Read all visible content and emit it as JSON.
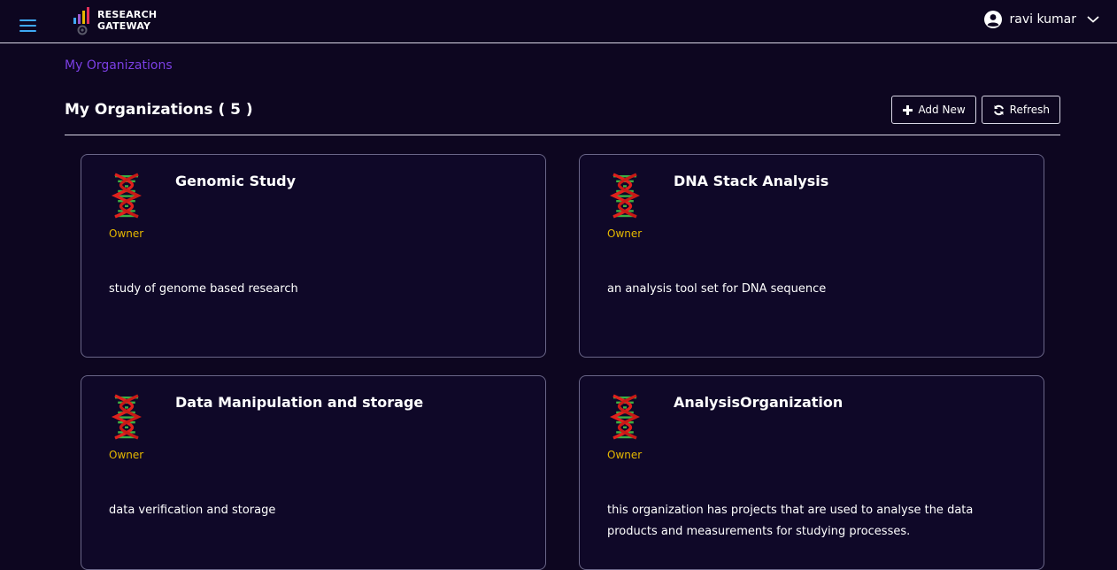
{
  "header": {
    "logo_line1": "RESEARCH",
    "logo_line2": "GATEWAY",
    "user_name": "ravi kumar"
  },
  "breadcrumb": "My Organizations",
  "page": {
    "title": "My Organizations ( 5 )",
    "add_new_label": "Add New",
    "refresh_label": "Refresh"
  },
  "organizations": [
    {
      "name": "Genomic Study",
      "role": "Owner",
      "description": "study of genome based research"
    },
    {
      "name": "DNA Stack Analysis",
      "role": "Owner",
      "description": "an analysis tool set for DNA sequence"
    },
    {
      "name": "Data Manipulation and storage",
      "role": "Owner",
      "description": "data verification and storage"
    },
    {
      "name": "AnalysisOrganization",
      "role": "Owner",
      "description": "this organization has projects that are used to analyse the data products and measurements for studying processes."
    }
  ],
  "colors": {
    "background": "#0d0620",
    "accent": "#7b3fe4",
    "owner": "#e6b800",
    "menu": "#3fa9f5"
  }
}
